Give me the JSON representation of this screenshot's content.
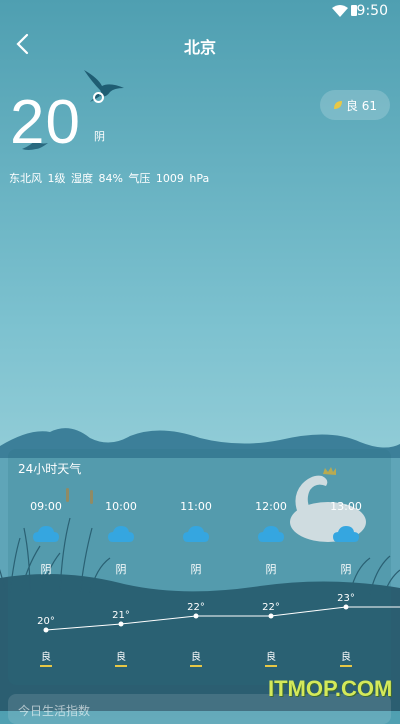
{
  "status": {
    "time": "9:50"
  },
  "header": {
    "city": "北京"
  },
  "current": {
    "temp": "20",
    "condition": "阴",
    "aqi_label": "良 61",
    "details": "东北风 1级  湿度 84%  气压 1009 hPa"
  },
  "hourly": {
    "title": "24小时天气",
    "hours": [
      {
        "time": "09:00",
        "condition": "阴",
        "temp": "20°",
        "aqi": "良"
      },
      {
        "time": "10:00",
        "condition": "阴",
        "temp": "21°",
        "aqi": "良"
      },
      {
        "time": "11:00",
        "condition": "阴",
        "temp": "22°",
        "aqi": "良"
      },
      {
        "time": "12:00",
        "condition": "阴",
        "temp": "22°",
        "aqi": "良"
      },
      {
        "time": "13:00",
        "condition": "阴",
        "temp": "23°",
        "aqi": "良"
      }
    ]
  },
  "next_section": {
    "title": "今日生活指数"
  },
  "watermark": "ITMOP.COM",
  "colors": {
    "accent_aqi": "#e8c845",
    "sky_top": "#4f9fb1",
    "hill": "#3c7f99"
  }
}
